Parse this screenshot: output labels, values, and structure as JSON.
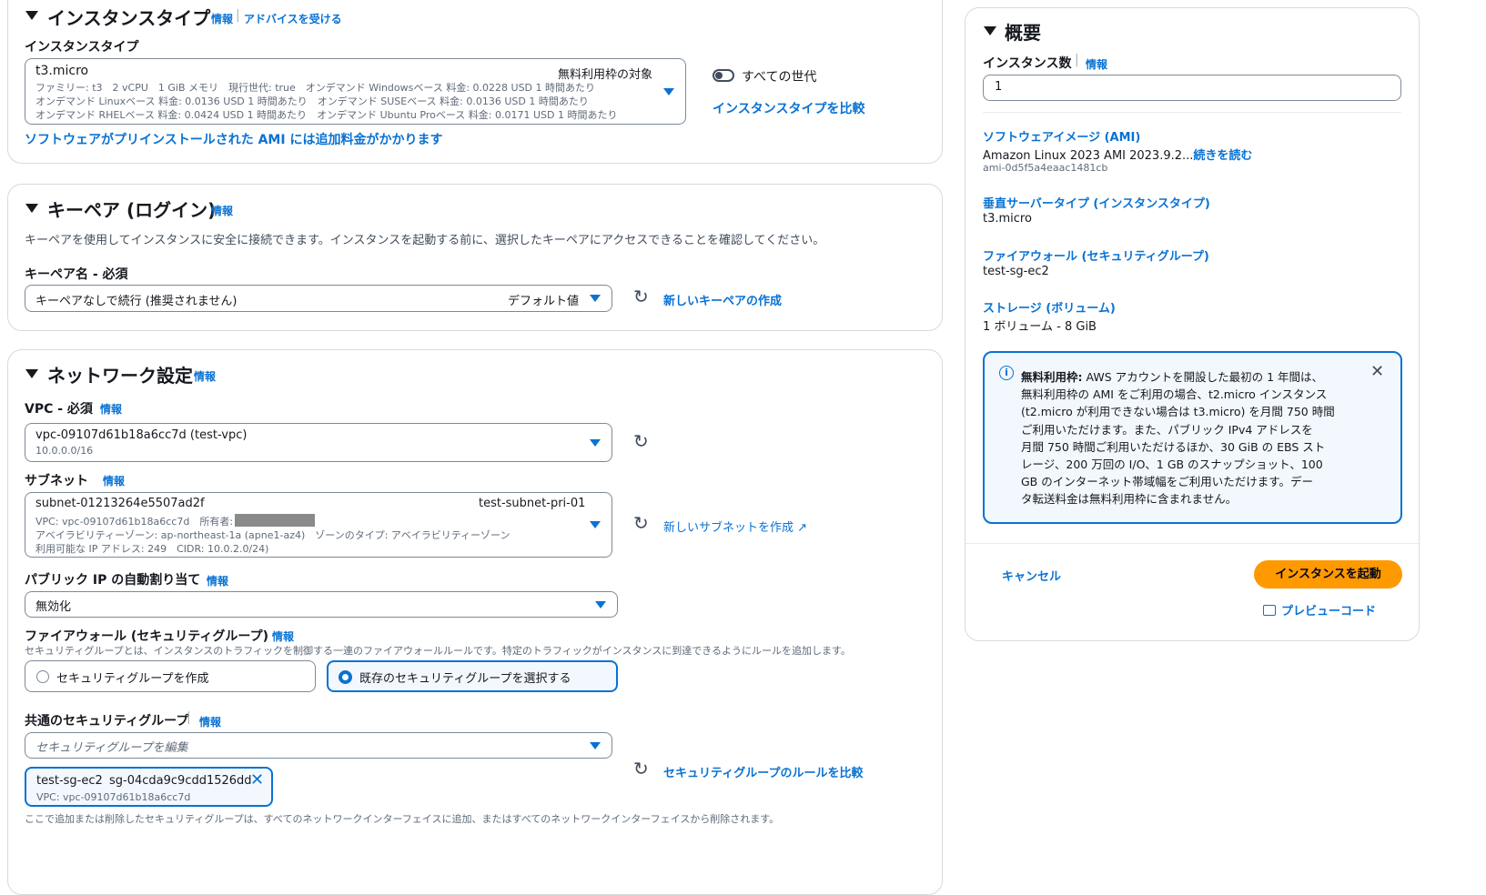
{
  "instance_type": {
    "heading": "インスタンスタイプ",
    "info": "情報",
    "advice_link": "アドバイスを受ける",
    "field_label": "インスタンスタイプ",
    "selected": "t3.micro",
    "free_tier_tag": "無料利用枠の対象",
    "detail_line1": "ファミリー: t3　2 vCPU　1 GiB メモリ　現行世代: true　オンデマンド Windowsベース 料金: 0.0228 USD 1 時間あたり",
    "detail_line2": "オンデマンド Linuxベース 料金: 0.0136 USD 1 時間あたり　オンデマンド SUSEベース 料金: 0.0136 USD 1 時間あたり",
    "detail_line3": "オンデマンド RHELベース 料金: 0.0424 USD 1 時間あたり　オンデマンド Ubuntu Proベース 料金: 0.0171 USD 1 時間あたり",
    "all_generations_toggle": "すべての世代",
    "compare_link": "インスタンスタイプを比較",
    "ami_note": "ソフトウェアがプリインストールされた AMI には追加料金がかかります"
  },
  "key_pair": {
    "heading": "キーペア (ログイン)",
    "info": "情報",
    "description": "キーペアを使用してインスタンスに安全に接続できます。インスタンスを起動する前に、選択したキーペアにアクセスできることを確認してください。",
    "field_label": "キーペア名 - 必須",
    "selected": "キーペアなしで続行 (推奨されません)",
    "default_tag": "デフォルト値",
    "create_link": "新しいキーペアの作成"
  },
  "network": {
    "heading": "ネットワーク設定",
    "info": "情報",
    "vpc_label": "VPC - 必須",
    "vpc_value": "vpc-09107d61b18a6cc7d (test-vpc)",
    "vpc_cidr": "10.0.0.0/16",
    "subnet_label": "サブネット",
    "subnet_id": "subnet-01213264e5507ad2f",
    "subnet_name": "test-subnet-pri-01",
    "subnet_line1": "VPC: vpc-09107d61b18a6cc7d　所有者:",
    "subnet_line2": "アベイラビリティーゾーン: ap-northeast-1a (apne1-az4)　ゾーンのタイプ: アベイラビリティーゾーン",
    "subnet_line3": "利用可能な IP アドレス: 249　CIDR: 10.0.2.0/24)",
    "new_subnet_link": "新しいサブネットを作成",
    "public_ip_label": "パブリック IP の自動割り当て",
    "public_ip_value": "無効化",
    "firewall_label": "ファイアウォール (セキュリティグループ)",
    "firewall_desc": "セキュリティグループとは、インスタンスのトラフィックを制御する一連のファイアウォールルールです。特定のトラフィックがインスタンスに到達できるようにルールを追加します。",
    "radio_create": "セキュリティグループを作成",
    "radio_existing": "既存のセキュリティグループを選択する",
    "common_sg_label": "共通のセキュリティグループ",
    "sg_placeholder": "セキュリティグループを編集",
    "sg_token_name": "test-sg-ec2",
    "sg_token_id": "sg-04cda9c9cdd1526dd",
    "sg_token_vpc": "VPC: vpc-09107d61b18a6cc7d",
    "compare_rules_link": "セキュリティグループのルールを比較",
    "footer_note": "ここで追加または削除したセキュリティグループは、すべてのネットワークインターフェイスに追加、またはすべてのネットワークインターフェイスから削除されます。"
  },
  "summary": {
    "heading": "概要",
    "count_label": "インスタンス数",
    "info": "情報",
    "count_value": "1",
    "ami_title": "ソフトウェアイメージ (AMI)",
    "ami_value": "Amazon Linux 2023 AMI 2023.9.2...",
    "read_more": "続きを読む",
    "ami_id": "ami-0d5f5a4eaac1481cb",
    "server_type_title": "垂直サーバータイプ (インスタンスタイプ)",
    "server_type_value": "t3.micro",
    "firewall_title": "ファイアウォール (セキュリティグループ)",
    "firewall_value": "test-sg-ec2",
    "storage_title": "ストレージ (ボリューム)",
    "storage_value": "1 ボリューム - 8 GiB",
    "alert_bold": "無料利用枠:",
    "alert_l1": "AWS アカウントを開設した最初の 1 年間は、",
    "alert_l2": "無料利用枠の AMI をご利用の場合、t2.micro インスタンス",
    "alert_l3": "(t2.micro が利用できない場合は t3.micro) を月間 750 時間",
    "alert_l4": "ご利用いただけます。また、パブリック IPv4 アドレスを",
    "alert_l5": "月間 750 時間ご利用いただけるほか、30 GiB の EBS スト",
    "alert_l6": "レージ、200 万回の I/O、1 GB のスナップショット、100",
    "alert_l7": "GB のインターネット帯域幅をご利用いただけます。デー",
    "alert_l8": "タ転送料金は無料利用枠に含まれません。",
    "cancel": "キャンセル",
    "launch": "インスタンスを起動",
    "preview_code": "プレビューコード"
  },
  "colors": {
    "link": "#0972d3",
    "primary_button": "#ff9900",
    "alert_border": "#0972d3",
    "alert_bg": "#f2f8fd"
  }
}
